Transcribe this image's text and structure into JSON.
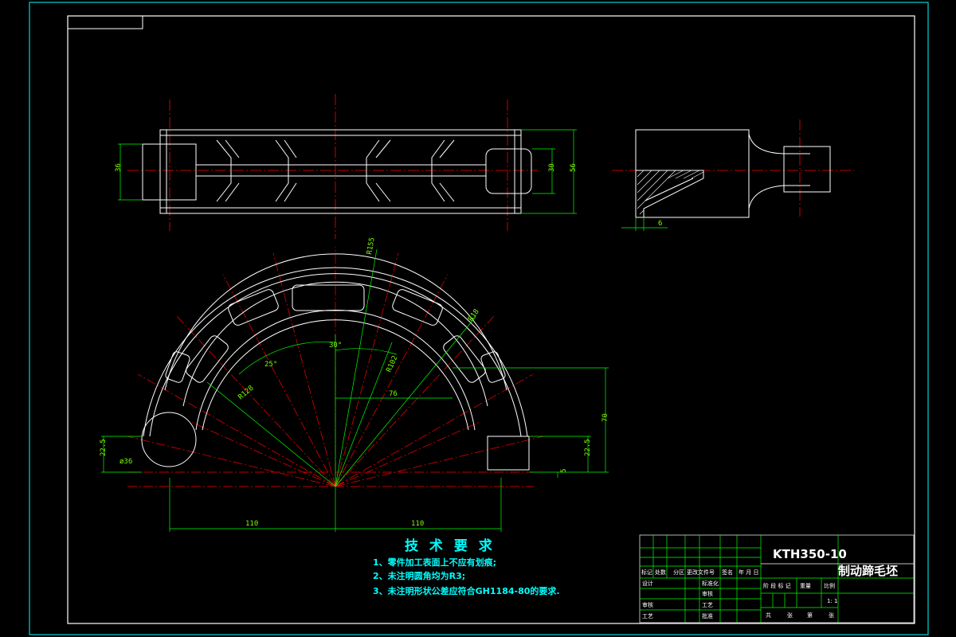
{
  "drawing": {
    "part_number": "KTH350-10",
    "part_name": "制动蹄毛坯",
    "scale": "1: 1"
  },
  "tech_requirements": {
    "title": "技 术 要 求",
    "lines": [
      "1、零件加工表面上不应有划痕;",
      "2、未注明圆角均为R3;",
      "3、未注明形状公差应符合GH1184-80的要求."
    ]
  },
  "dimensions": {
    "top_left_height": "36",
    "top_right_inner": "30",
    "top_right_outer": "56",
    "side_thickness": "6",
    "bottom_half_left": "110",
    "bottom_half_right": "110",
    "offset_76": "76",
    "height_70": "70",
    "right_22_5": "22.5",
    "left_22_5": "22.5",
    "right_5": "5",
    "angle_30": "30°",
    "angle_25": "25°",
    "dia_36": "ø36",
    "r_outer": "R155",
    "r_mid": "R102",
    "r_inner": "R128",
    "r_18": "R18"
  },
  "title_block": {
    "row_labels": [
      "标记",
      "处数",
      "分区",
      "更改文件号",
      "签名",
      "年 月 日"
    ],
    "design": "设计",
    "standardize": "标准化",
    "review": "审核",
    "process": "工艺",
    "check": "审核",
    "approve": "批准",
    "stage_mark": "阶 段 标 记",
    "weight": "重量",
    "ratio": "比例",
    "total": "共",
    "sheet": "张",
    "of": "第",
    "sheet2": "张"
  },
  "colors": {
    "background": "#000000",
    "frame": "#ffffff",
    "border_outer": "#00ffff",
    "centerline": "#ff0000",
    "dimension": "#00ff00",
    "text_tech": "#00ffff"
  }
}
